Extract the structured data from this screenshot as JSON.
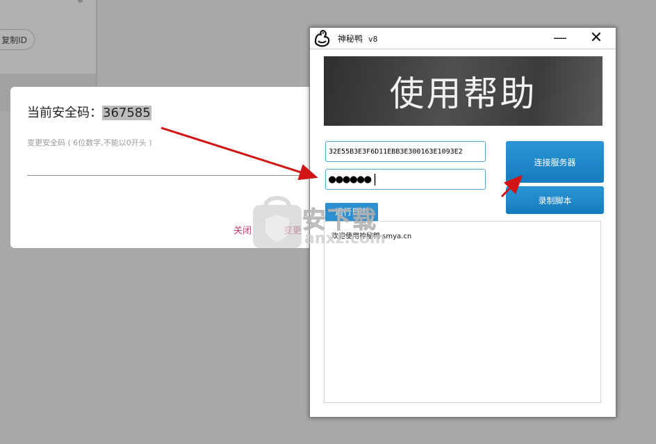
{
  "background": {
    "copy_id_label": "复制ID"
  },
  "modal": {
    "title_label": "当前安全码：",
    "code": "367585",
    "hint": "变更安全码 ( 6位数字,不能以0开头 )",
    "input_value": "",
    "close_label": "关闭",
    "change_label": "变更"
  },
  "app": {
    "title": "神秘鸭",
    "version": "v8",
    "minimize_symbol": "—",
    "close_symbol": "✕",
    "banner_text": "使用帮助",
    "device_id": "32E55B3E3F6D11EBB3E300163E1093E2",
    "password_mask": "●●●●●●|",
    "connect_label": "连接服务器",
    "record_label": "录制脚本",
    "log_tab_label": "运行日志",
    "log_message": "欢迎使用神秘鸭 smya.cn"
  },
  "watermark": {
    "text": "安下载",
    "url": "anxz.com"
  },
  "colors": {
    "accent_blue": "#1a84c9",
    "link_pink": "#c03a6f",
    "arrow_red": "#d11414"
  },
  "icons": {
    "app_logo": "duck-icon",
    "watermark": "shield-bag-icon"
  }
}
